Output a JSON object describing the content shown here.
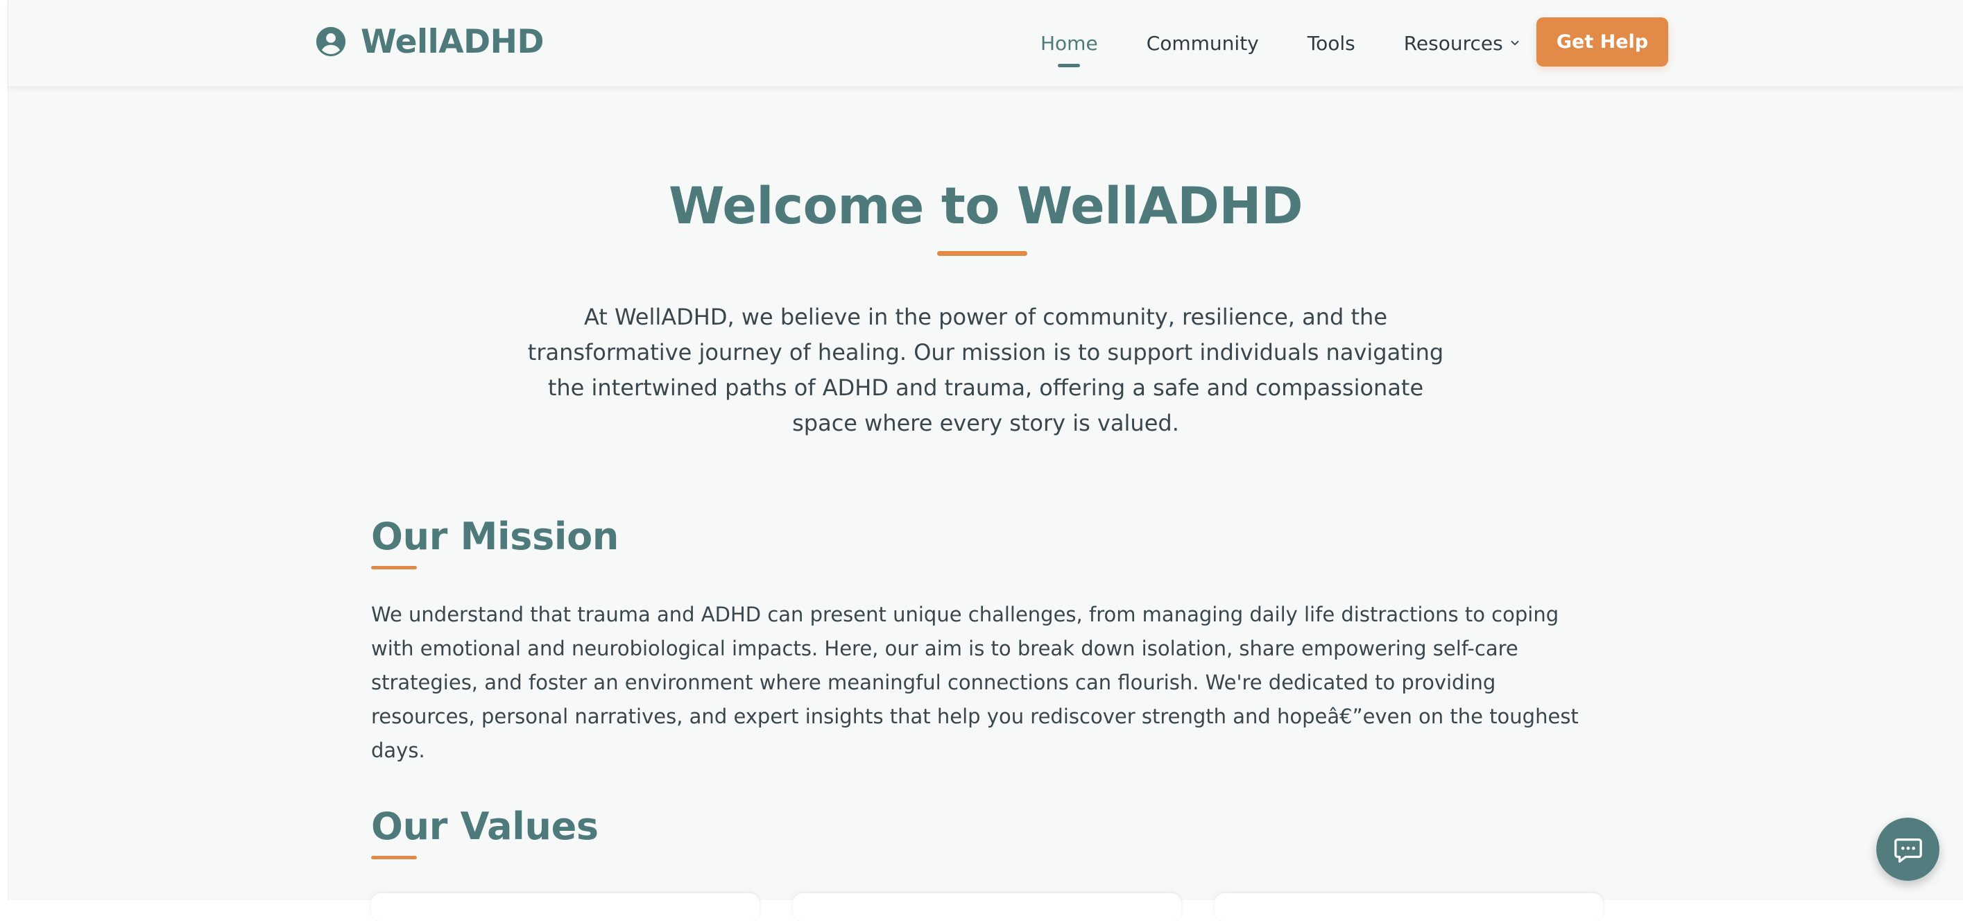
{
  "brand": {
    "name": "WellADHD",
    "icon": "user-circle-icon"
  },
  "nav": {
    "items": [
      {
        "label": "Home",
        "active": true
      },
      {
        "label": "Community",
        "active": false
      },
      {
        "label": "Tools",
        "active": false
      },
      {
        "label": "Resources",
        "active": false,
        "has_dropdown": true
      }
    ],
    "cta_label": "Get Help"
  },
  "hero": {
    "title": "Welcome to WellADHD",
    "text": "At WellADHD, we believe in the power of community, resilience, and the transformative journey of healing. Our mission is to support individuals navigating the intertwined paths of ADHD and trauma, offering a safe and compassionate space where every story is valued."
  },
  "mission": {
    "title": "Our Mission",
    "text": "We understand that trauma and ADHD can present unique challenges, from managing daily life distractions to coping with emotional and neurobiological impacts. Here, our aim is to break down isolation, share empowering self-care strategies, and foster an environment where meaningful connections can flourish. We're dedicated to providing resources, personal narratives, and expert insights that help you rediscover strength and hopeâ€”even on the toughest days."
  },
  "values": {
    "title": "Our Values"
  },
  "chat": {
    "icon": "chat-bubble-icon"
  },
  "colors": {
    "primary": "#4f7a7b",
    "accent": "#e28a48",
    "background": "#f7f8f8",
    "text": "#39474d"
  }
}
